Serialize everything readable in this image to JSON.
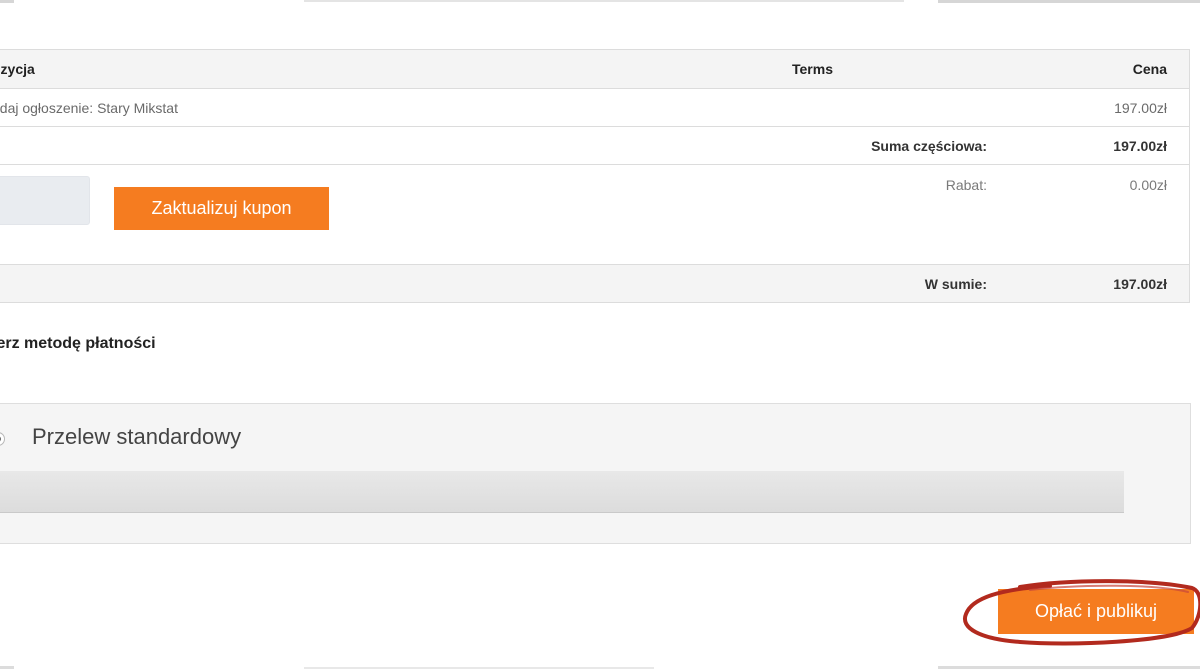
{
  "order_table": {
    "headers": {
      "item": "ozycja",
      "terms": "Terms",
      "price": "Cena"
    },
    "item_row": {
      "name": "odaj ogłoszenie: Stary Mikstat",
      "price": "197.00zł"
    },
    "subtotal": {
      "label": "Suma częściowa:",
      "value": "197.00zł"
    },
    "coupon": {
      "input_value": "",
      "update_button_label": "Zaktualizuj kupon"
    },
    "discount": {
      "label": "Rabat:",
      "value": "0.00zł"
    },
    "total": {
      "label": "W sumie:",
      "value": "197.00zł"
    }
  },
  "payment": {
    "section_title": "ierz metodę płatności",
    "methods": [
      {
        "label": "Przelew standardowy",
        "selected": true
      }
    ]
  },
  "actions": {
    "pay_button_label": "Opłać i publikuj"
  },
  "colors": {
    "accent": "#f57c20",
    "highlight_circle": "#b22a1e"
  }
}
